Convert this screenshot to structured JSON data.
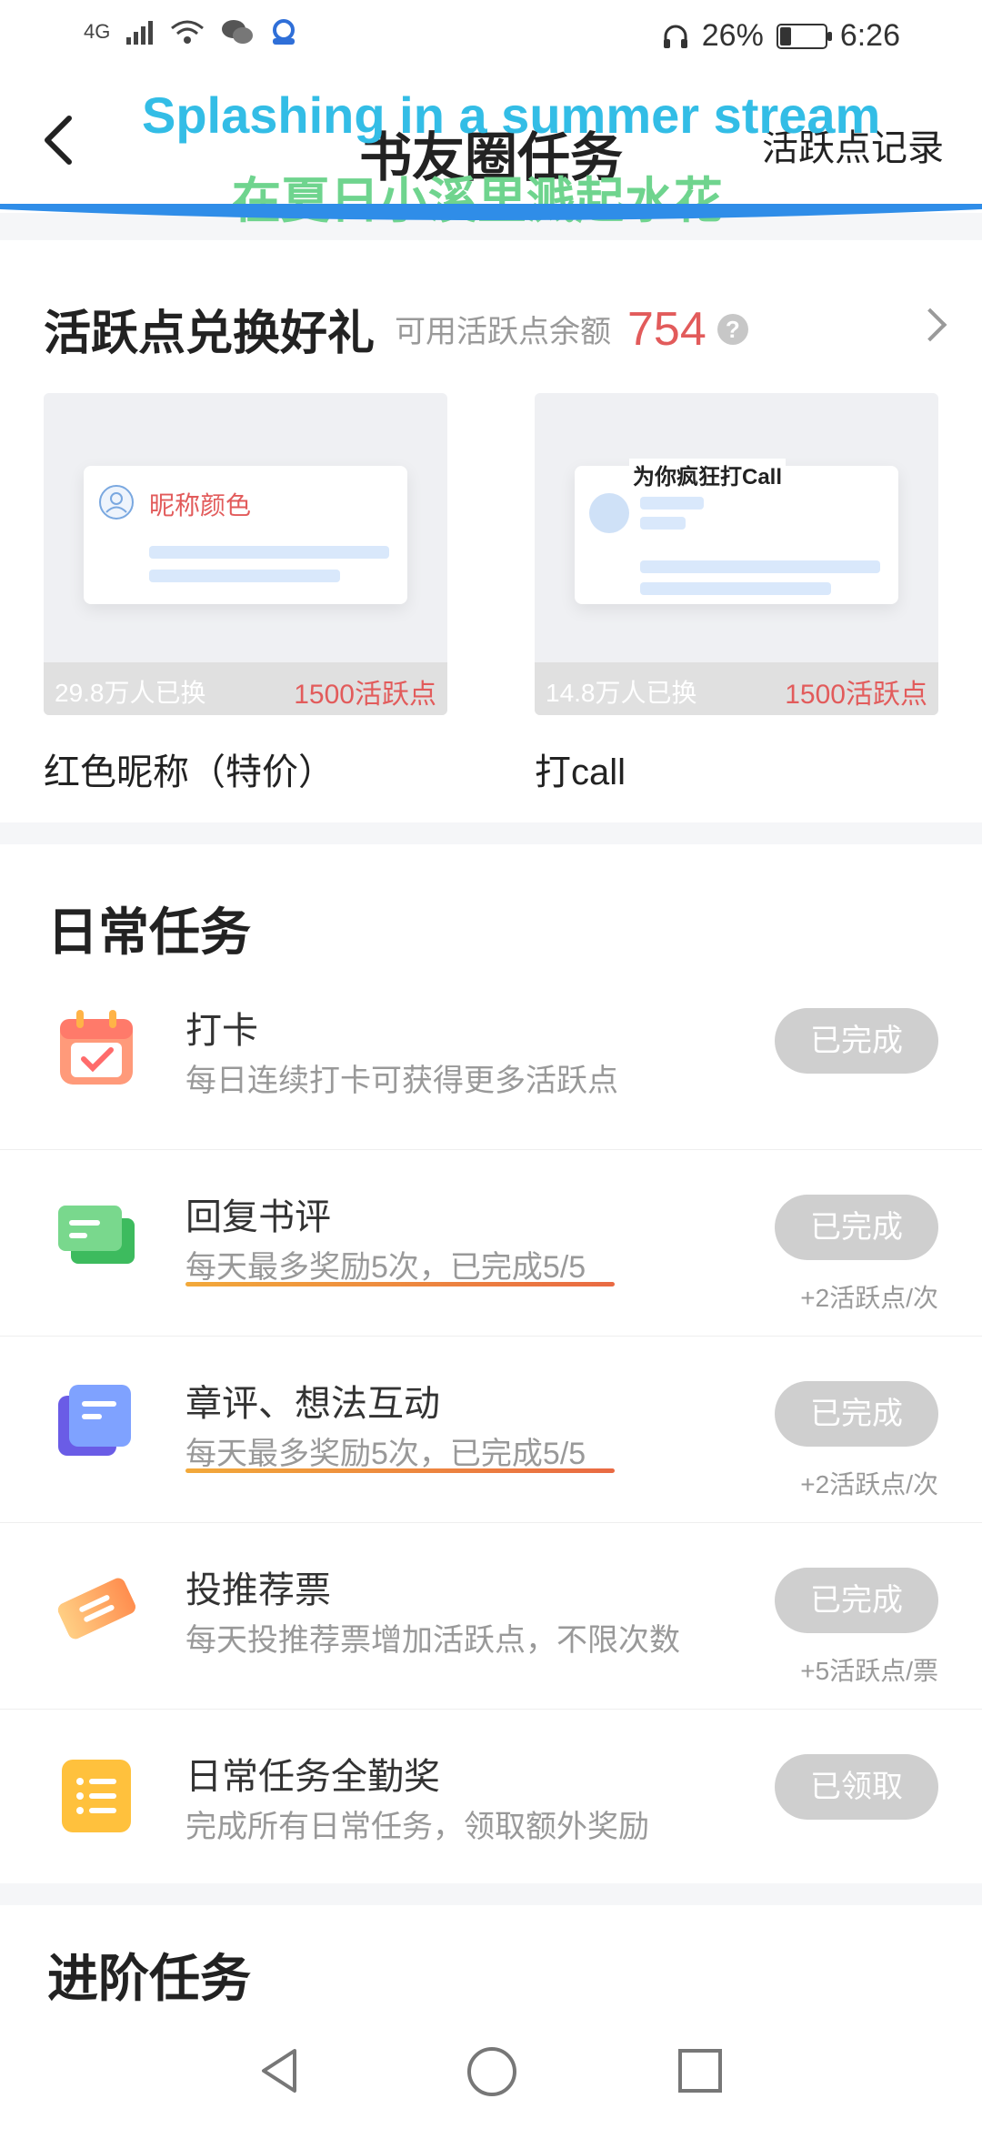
{
  "status_bar": {
    "network": "4G",
    "battery_percent": "26%",
    "battery_level": 0.26,
    "time": "6:26"
  },
  "header": {
    "title": "书友圈任务",
    "record_link": "活跃点记录",
    "overlay_en": "Splashing in a summer stream",
    "overlay_cn": "在夏日小溪里溅起水花"
  },
  "exchange": {
    "title": "活跃点兑换好礼",
    "balance_label": "可用活跃点余额",
    "balance_value": "754",
    "help_glyph": "?",
    "gifts": [
      {
        "preview_label": "昵称颜色",
        "count": "29.8万人已换",
        "price": "1500活跃点",
        "name": "红色昵称（特价）"
      },
      {
        "preview_label": "为你疯狂打Call",
        "count": "14.8万人已换",
        "price": "1500活跃点",
        "name": "打call"
      }
    ]
  },
  "daily": {
    "title": "日常任务",
    "tasks": [
      {
        "icon": "calendar-check-icon",
        "name": "打卡",
        "desc": "每日连续打卡可获得更多活跃点",
        "button": "已完成",
        "reward": ""
      },
      {
        "icon": "chat-bubbles-icon",
        "name": "回复书评",
        "desc": "每天最多奖励5次，已完成5/5",
        "button": "已完成",
        "reward": "+2活跃点/次"
      },
      {
        "icon": "notes-stack-icon",
        "name": "章评、想法互动",
        "desc": "每天最多奖励5次，已完成5/5",
        "button": "已完成",
        "reward": "+2活跃点/次"
      },
      {
        "icon": "ticket-icon",
        "name": "投推荐票",
        "desc": "每天投推荐票增加活跃点，不限次数",
        "button": "已完成",
        "reward": "+5活跃点/票"
      },
      {
        "icon": "list-icon",
        "name": "日常任务全勤奖",
        "desc": "完成所有日常任务，领取额外奖励",
        "button": "已领取",
        "reward": ""
      }
    ]
  },
  "advanced": {
    "title": "进阶任务"
  },
  "colors": {
    "accent_red": "#e25b5b",
    "header_wave": "#2f8de8",
    "button_disabled": "#cfcfcf",
    "underline_gradient": [
      "#f2a93a",
      "#e96a43"
    ]
  }
}
